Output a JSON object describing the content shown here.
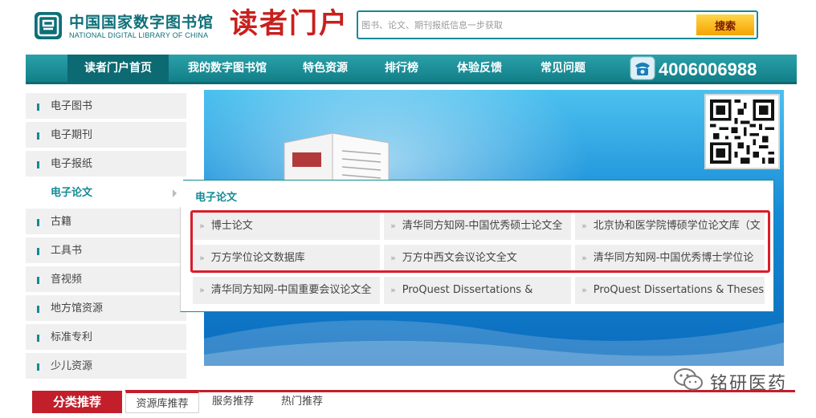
{
  "header": {
    "logo_cn": "中国国家数字图书馆",
    "logo_en": "NATIONAL DIGITAL LIBRARY OF CHINA",
    "portal_title": "读者门户",
    "search_placeholder": "图书、论文、期刊报纸信息一步获取",
    "search_button": "搜索"
  },
  "nav": {
    "items": [
      {
        "label": "读者门户首页"
      },
      {
        "label": "我的数字图书馆"
      },
      {
        "label": "特色资源"
      },
      {
        "label": "排行榜"
      },
      {
        "label": "体验反馈"
      },
      {
        "label": "常见问题"
      }
    ],
    "phone": "4006006988"
  },
  "sidebar": {
    "items": [
      {
        "label": "电子图书"
      },
      {
        "label": "电子期刊"
      },
      {
        "label": "电子报纸"
      },
      {
        "label": "电子论文"
      },
      {
        "label": "古籍"
      },
      {
        "label": "工具书"
      },
      {
        "label": "音视频"
      },
      {
        "label": "地方馆资源"
      },
      {
        "label": "标准专利"
      },
      {
        "label": "少儿资源"
      }
    ]
  },
  "dropdown": {
    "title": "电子论文",
    "chevron": "»",
    "cells": [
      "博士论文",
      "清华同方知网-中国优秀硕士论文全",
      "北京协和医学院博硕学位论文库（文",
      "万方学位论文数据库",
      "万方中西文会议论文全文",
      "清华同方知网-中国优秀博士学位论",
      "清华同方知网-中国重要会议论文全",
      "ProQuest Dissertations &",
      "ProQuest Dissertations & Theses:"
    ]
  },
  "bottom": {
    "category_title": "分类推荐",
    "tabs": [
      {
        "label": "资源库推荐"
      },
      {
        "label": "服务推荐"
      },
      {
        "label": "热门推荐"
      }
    ]
  },
  "watermark": {
    "text": "铭研医药"
  },
  "colors": {
    "teal": "#148a94",
    "brand_red": "#c8201d",
    "highlight_red": "#d81d2a",
    "search_yellow": "#f5a400"
  }
}
